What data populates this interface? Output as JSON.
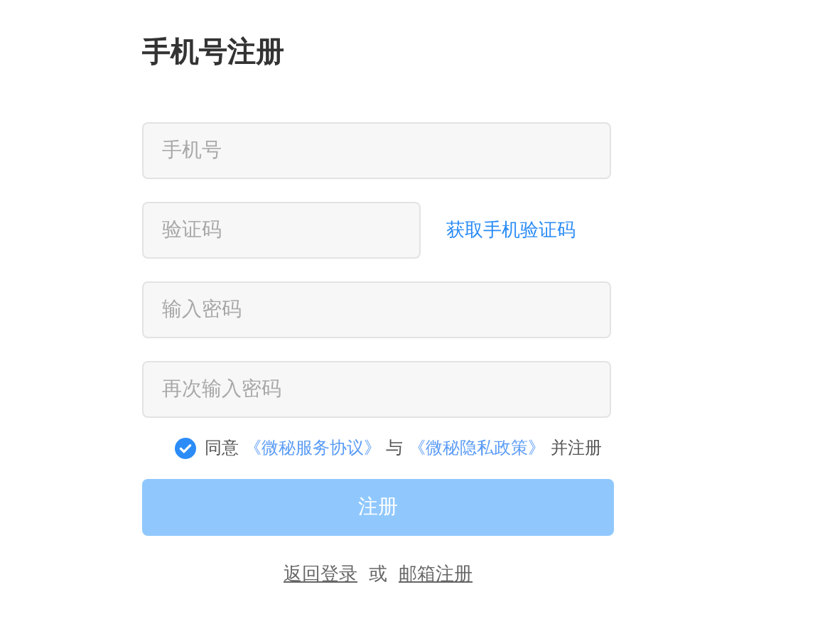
{
  "title": "手机号注册",
  "fields": [
    {
      "kind": "input",
      "placeholder": "手机号"
    },
    {
      "kind": "code",
      "placeholder": "验证码",
      "action": "获取手机验证码"
    },
    {
      "kind": "password",
      "placeholder": "输入密码"
    },
    {
      "kind": "password",
      "placeholder": "再次输入密码"
    }
  ],
  "agreement": {
    "checked": true,
    "parts": [
      {
        "kind": "text",
        "text": "同意"
      },
      {
        "kind": "link",
        "text": "《微秘服务协议》"
      },
      {
        "kind": "text",
        "text": "与"
      },
      {
        "kind": "link",
        "text": "《微秘隐私政策》"
      },
      {
        "kind": "text",
        "text": "并注册"
      }
    ]
  },
  "submit": {
    "label": "注册",
    "disabled": true
  },
  "footer": [
    {
      "kind": "link",
      "text": "返回登录"
    },
    {
      "kind": "text",
      "text": "或"
    },
    {
      "kind": "link",
      "text": "邮箱注册"
    }
  ]
}
